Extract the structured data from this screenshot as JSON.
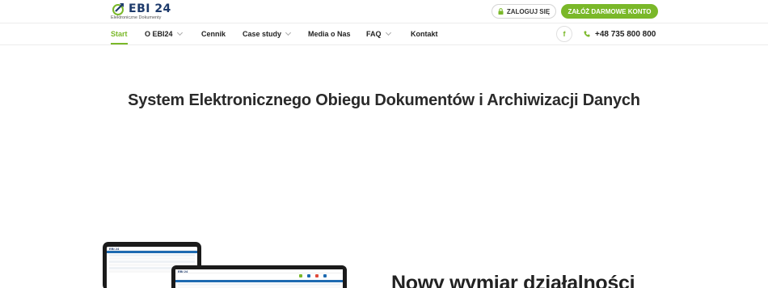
{
  "brand": {
    "name": "EBI 24",
    "tagline": "Elektroniczne Dokumenty",
    "color": "#1d3a6b",
    "accent": "#7ab829"
  },
  "header": {
    "login_label": "ZALOGUJ SIĘ",
    "login_icon": "lock-icon",
    "register_label": "ZAŁÓŻ DARMOWE KONTO"
  },
  "nav": {
    "items": [
      {
        "label": "Start",
        "active": true,
        "dropdown": false
      },
      {
        "label": "O EBI24",
        "active": false,
        "dropdown": true
      },
      {
        "label": "Cennik",
        "active": false,
        "dropdown": false
      },
      {
        "label": "Case study",
        "active": false,
        "dropdown": true
      },
      {
        "label": "Media o Nas",
        "active": false,
        "dropdown": false
      },
      {
        "label": "FAQ",
        "active": false,
        "dropdown": true
      },
      {
        "label": "Kontakt",
        "active": false,
        "dropdown": false
      }
    ],
    "facebook_icon_text": "f",
    "phone": "+48 735 800 800"
  },
  "hero": {
    "title": "System Elektronicznego Obiegu Dokumentów i Archiwizacji Danych",
    "subtitle": "Nowy wymiar działalności"
  },
  "devices": {
    "screen_logo": "EBI 24"
  }
}
